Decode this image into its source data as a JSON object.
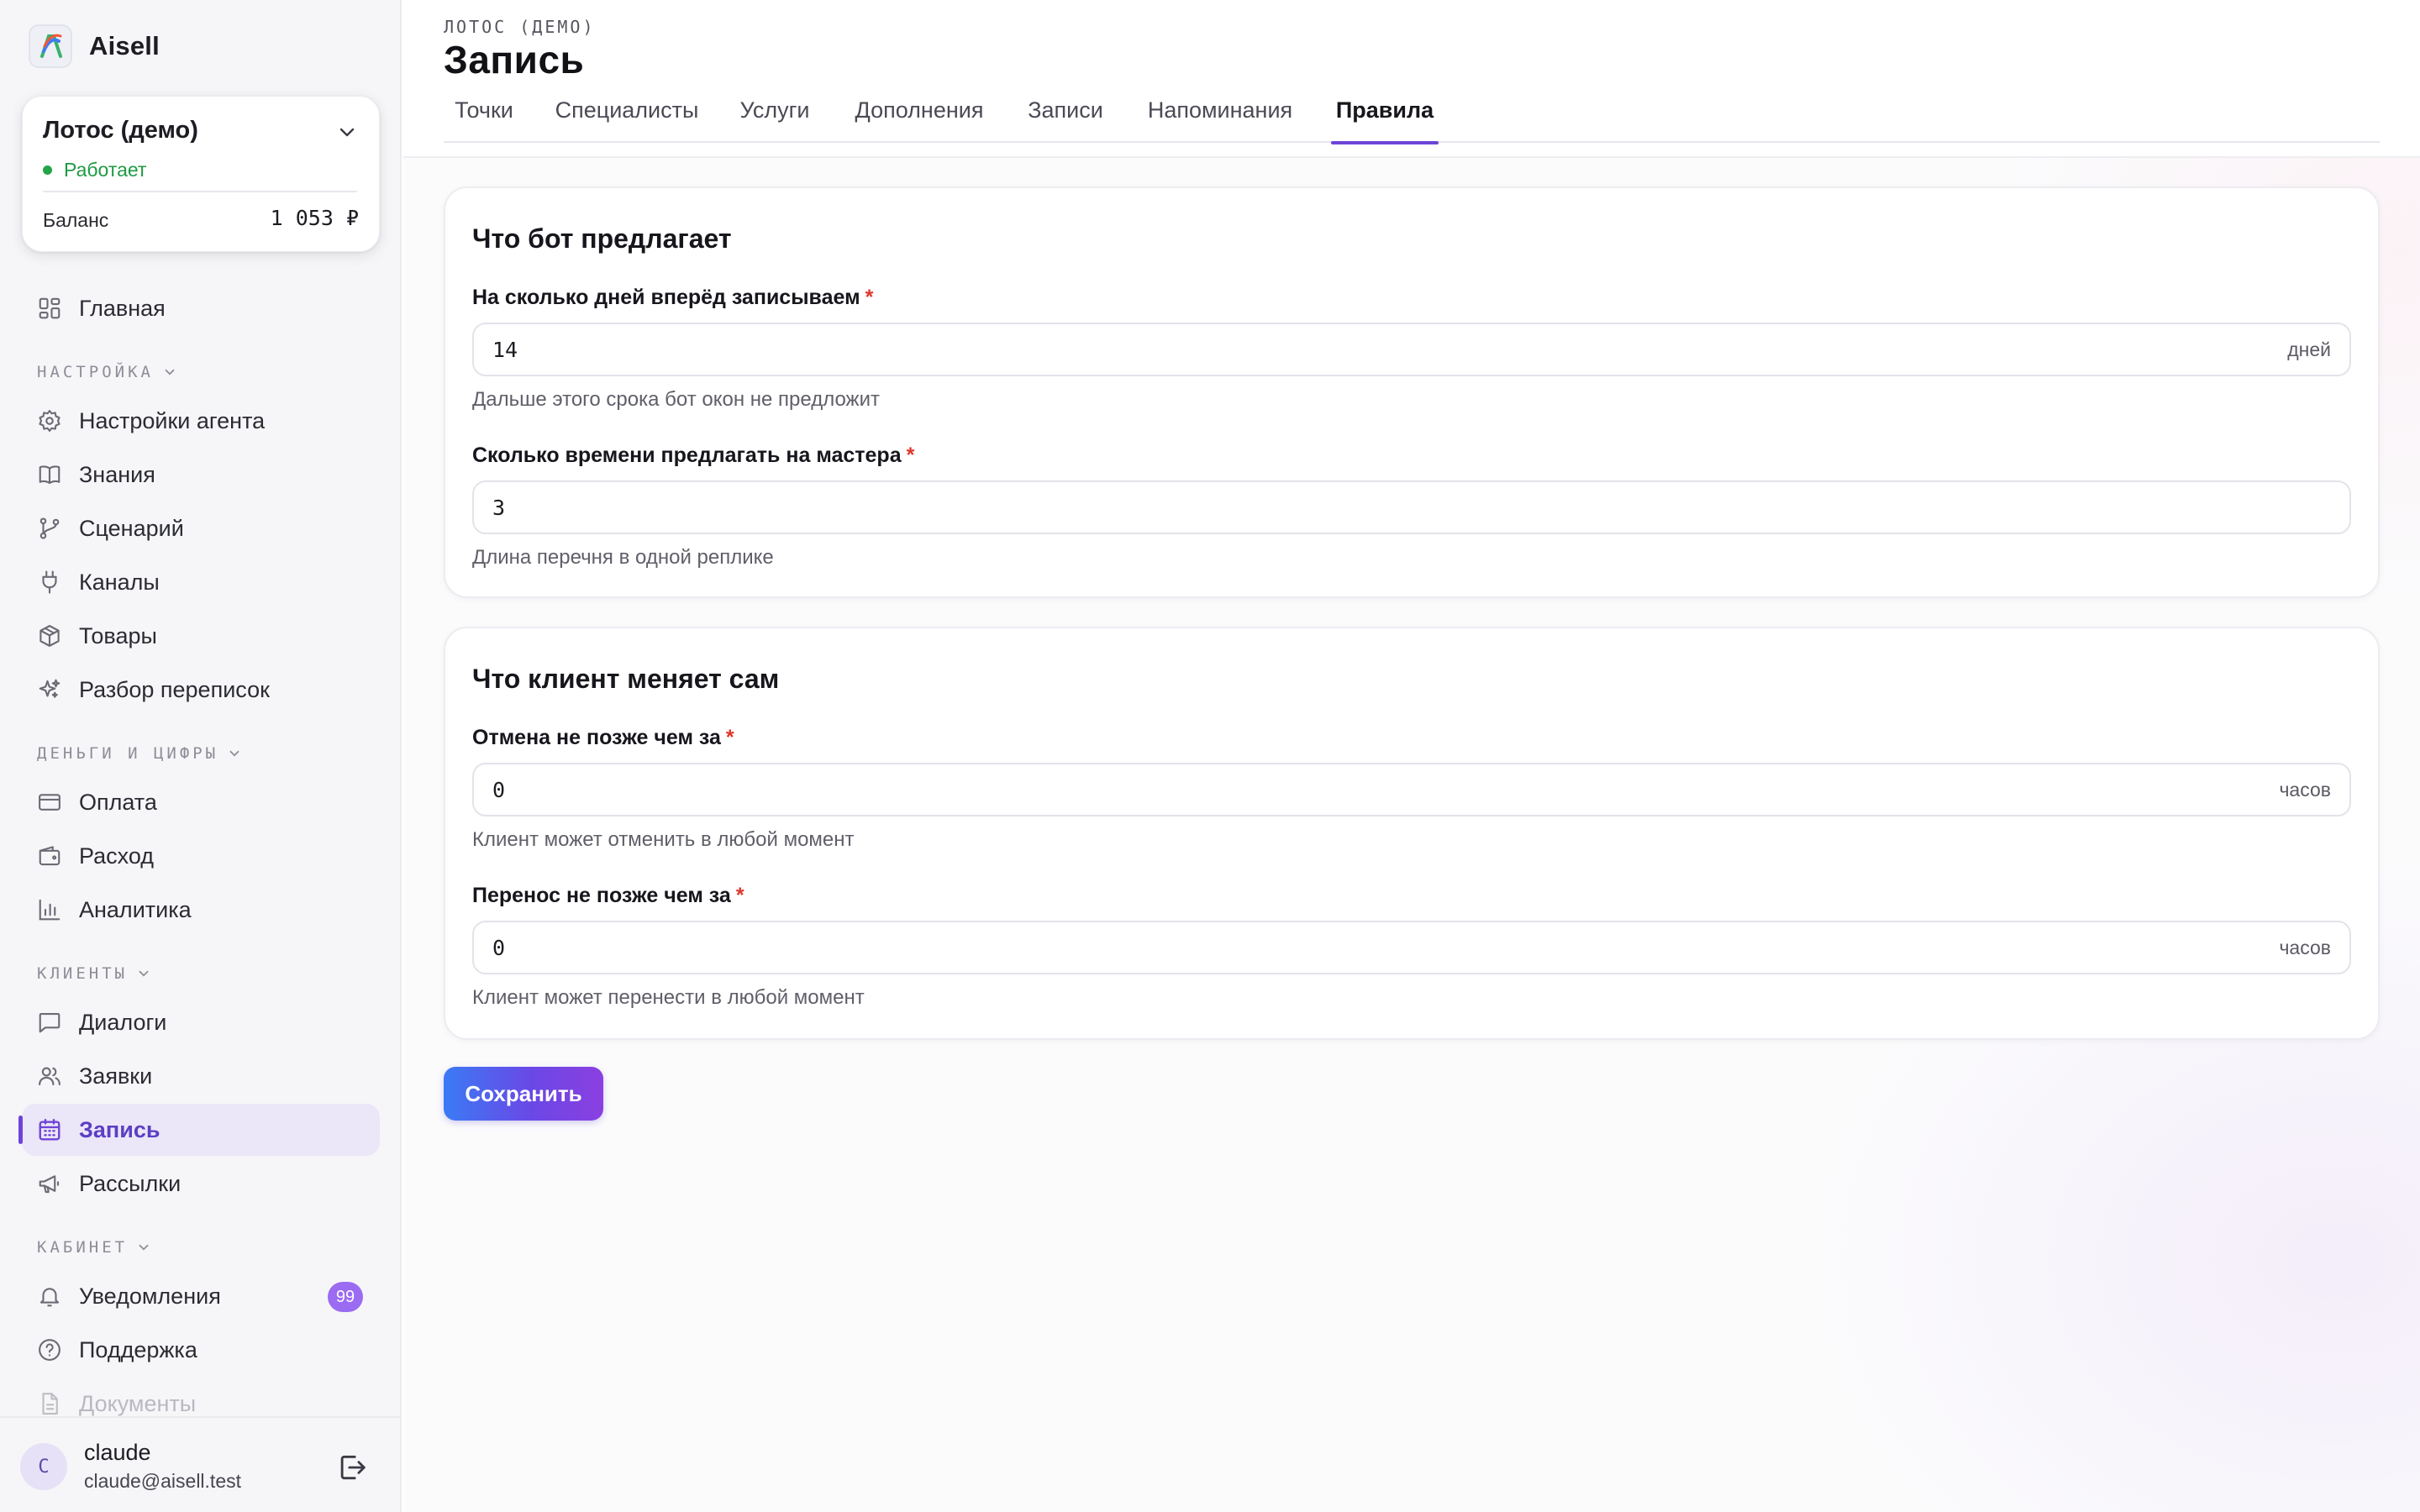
{
  "brand": {
    "name": "Aisell"
  },
  "account": {
    "name": "Лотос (демо)",
    "status": "Работает",
    "status_color": "#1f9a44",
    "balance_label": "Баланс",
    "balance_value": "1 053 ₽"
  },
  "nav": {
    "home": "Главная",
    "sections": {
      "settings": "НАСТРОЙКА",
      "money": "ДЕНЬГИ И ЦИФРЫ",
      "clients": "КЛИЕНТЫ",
      "cabinet": "КАБИНЕТ"
    },
    "settings_items": [
      {
        "label": "Настройки агента",
        "icon": "gear-icon"
      },
      {
        "label": "Знания",
        "icon": "book-icon"
      },
      {
        "label": "Сценарий",
        "icon": "branch-icon"
      },
      {
        "label": "Каналы",
        "icon": "plug-icon"
      },
      {
        "label": "Товары",
        "icon": "box-icon"
      },
      {
        "label": "Разбор переписок",
        "icon": "sparkles-icon"
      }
    ],
    "money_items": [
      {
        "label": "Оплата",
        "icon": "card-icon"
      },
      {
        "label": "Расход",
        "icon": "wallet-icon"
      },
      {
        "label": "Аналитика",
        "icon": "bar-chart-icon"
      }
    ],
    "clients_items": [
      {
        "label": "Диалоги",
        "icon": "chat-icon"
      },
      {
        "label": "Заявки",
        "icon": "users-icon"
      },
      {
        "label": "Запись",
        "icon": "calendar-icon",
        "active": true
      },
      {
        "label": "Рассылки",
        "icon": "megaphone-icon"
      }
    ],
    "cabinet_items": [
      {
        "label": "Уведомления",
        "icon": "bell-icon",
        "badge": "99"
      },
      {
        "label": "Поддержка",
        "icon": "help-icon"
      },
      {
        "label": "Документы",
        "icon": "document-icon"
      }
    ]
  },
  "user": {
    "initial": "C",
    "name": "claude",
    "email": "claude@aisell.test"
  },
  "header": {
    "breadcrumb": "ЛОТОС (ДЕМО)",
    "title": "Запись",
    "tabs": [
      {
        "label": "Точки"
      },
      {
        "label": "Специалисты"
      },
      {
        "label": "Услуги"
      },
      {
        "label": "Дополнения"
      },
      {
        "label": "Записи"
      },
      {
        "label": "Напоминания"
      },
      {
        "label": "Правила",
        "active": true
      }
    ]
  },
  "offer_section": {
    "title": "Что бот предлагает",
    "days_ahead": {
      "label": "На сколько дней вперёд записываем",
      "required_mark": "*",
      "value": "14",
      "suffix": "дней",
      "hint": "Дальше этого срока бот окон не предложит"
    },
    "slots_per_master": {
      "label": "Сколько времени предлагать на мастера",
      "required_mark": "*",
      "value": "3",
      "hint": "Длина перечня в одной реплике"
    }
  },
  "client_section": {
    "title": "Что клиент меняет сам",
    "cancel_before": {
      "label": "Отмена не позже чем за",
      "required_mark": "*",
      "value": "0",
      "suffix": "часов",
      "hint": "Клиент может отменить в любой момент"
    },
    "reschedule_before": {
      "label": "Перенос не позже чем за",
      "required_mark": "*",
      "value": "0",
      "suffix": "часов",
      "hint": "Клиент может перенести в любой момент"
    }
  },
  "actions": {
    "save_label": "Сохранить"
  },
  "colors": {
    "accent": "#6d44d8",
    "required": "#e0362c",
    "badge": "#9b6bf2"
  }
}
